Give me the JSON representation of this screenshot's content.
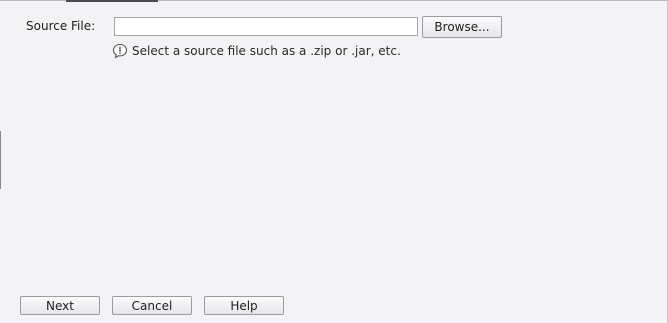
{
  "form": {
    "source_file_label": "Source File:",
    "source_file_value": "",
    "browse_label": "Browse...",
    "hint_text": "Select a source file such as a .zip or .jar, etc.",
    "hint_icon": "info-speech-bubble-icon"
  },
  "footer": {
    "next_label": "Next",
    "cancel_label": "Cancel",
    "help_label": "Help"
  },
  "colors": {
    "background": "#f3f2f4",
    "button_border": "#9c9ba1",
    "input_border": "#a7a6ab"
  }
}
